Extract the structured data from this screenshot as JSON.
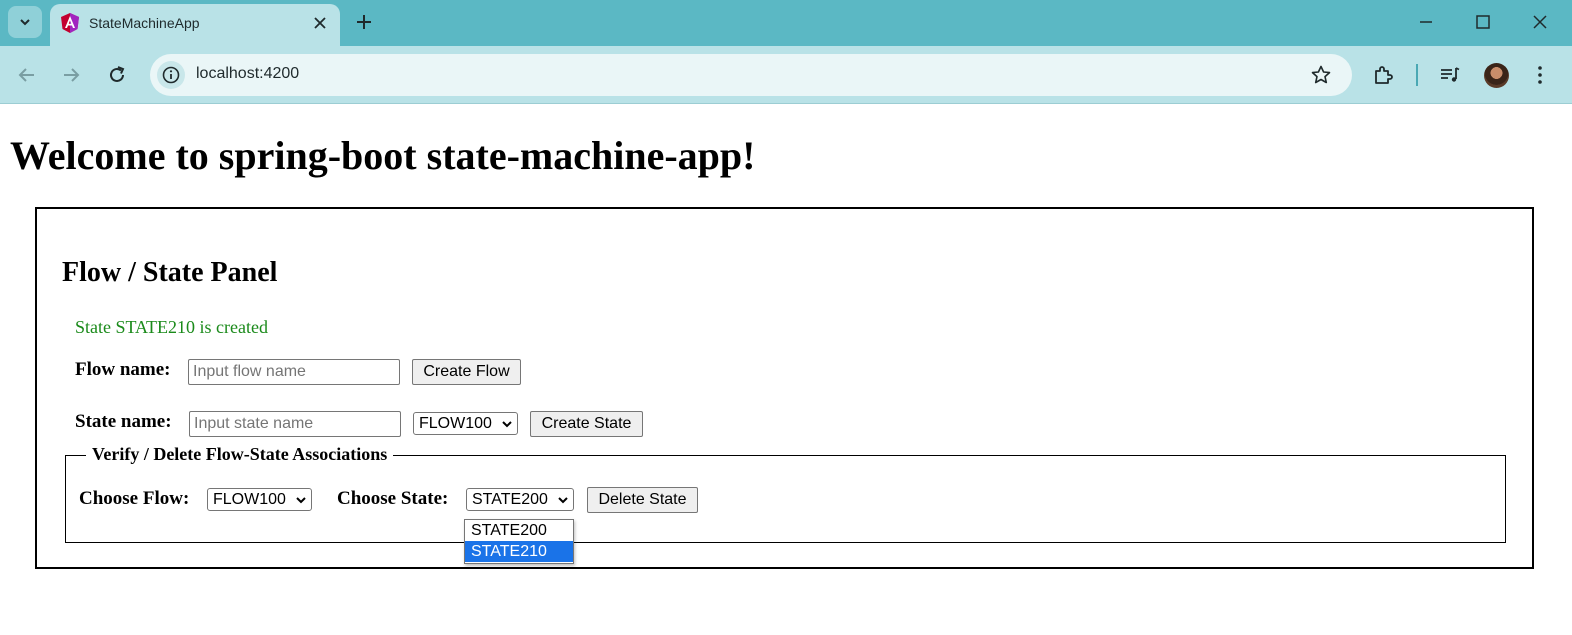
{
  "browser": {
    "tab_title": "StateMachineApp",
    "url": "localhost:4200"
  },
  "page": {
    "title": "Welcome to spring-boot state-machine-app!"
  },
  "panel": {
    "title": "Flow / State Panel",
    "status_message": "State STATE210 is created",
    "status_color": "#1a8a1a",
    "flow_label": "Flow name:",
    "flow_placeholder": "Input flow name",
    "flow_value": "",
    "create_flow_label": "Create Flow",
    "state_label": "State name:",
    "state_placeholder": "Input state name",
    "state_value": "",
    "state_flow_select": "FLOW100",
    "create_state_label": "Create State"
  },
  "assoc": {
    "legend": "Verify / Delete Flow-State Associations",
    "choose_flow_label": "Choose Flow:",
    "flow_select": "FLOW100",
    "choose_state_label": "Choose State:",
    "state_select": "STATE200",
    "delete_state_label": "Delete State",
    "state_options": [
      "STATE200",
      "STATE210"
    ],
    "highlighted_option": "STATE210",
    "highlight_color": "#1a73e8"
  }
}
